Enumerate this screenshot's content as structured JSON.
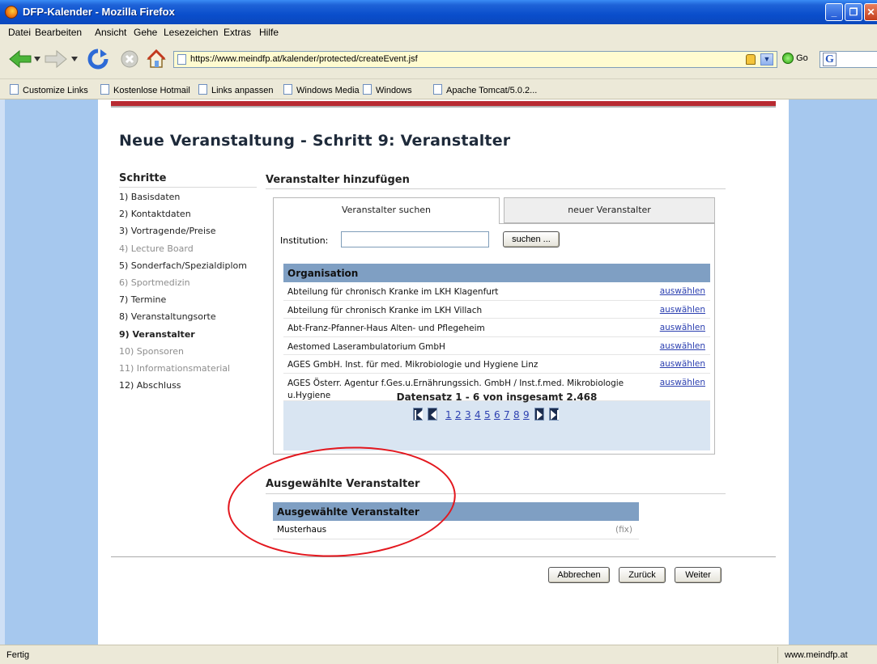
{
  "window": {
    "title": "DFP-Kalender - Mozilla Firefox"
  },
  "menu": [
    "Datei",
    "Bearbeiten",
    "Ansicht",
    "Gehe",
    "Lesezeichen",
    "Extras",
    "Hilfe"
  ],
  "nav": {
    "url": "https://www.meindfp.at/kalender/protected/createEvent.jsf",
    "go_label": "Go"
  },
  "bookmarks": [
    "Customize Links",
    "Kostenlose Hotmail",
    "Links anpassen",
    "Windows Media",
    "Windows",
    "Apache Tomcat/5.0.2..."
  ],
  "page": {
    "heading": "Neue Veranstaltung - Schritt 9: Veranstalter",
    "steps_title": "Schritte",
    "steps": [
      {
        "label": "1) Basisdaten",
        "state": "normal"
      },
      {
        "label": "2) Kontaktdaten",
        "state": "normal"
      },
      {
        "label": "3) Vortragende/Preise",
        "state": "normal"
      },
      {
        "label": "4) Lecture Board",
        "state": "dim"
      },
      {
        "label": "5) Sonderfach/Spezialdiplom",
        "state": "normal"
      },
      {
        "label": "6) Sportmedizin",
        "state": "dim"
      },
      {
        "label": "7) Termine",
        "state": "normal"
      },
      {
        "label": "8) Veranstaltungsorte",
        "state": "normal"
      },
      {
        "label": "9) Veranstalter",
        "state": "active"
      },
      {
        "label": "10) Sponsoren",
        "state": "dim"
      },
      {
        "label": "11) Informationsmaterial",
        "state": "dim"
      },
      {
        "label": "12) Abschluss",
        "state": "normal"
      }
    ],
    "add_section_title": "Veranstalter hinzufügen",
    "tabs": {
      "search": "Veranstalter suchen",
      "new": "neuer Veranstalter"
    },
    "institution_label": "Institution:",
    "institution_value": "",
    "search_button": "suchen ...",
    "table_header": "Organisation",
    "rows": [
      {
        "name": "Abteilung für chronisch Kranke im LKH Klagenfurt",
        "action": "auswählen"
      },
      {
        "name": "Abteilung für chronisch Kranke im LKH Villach",
        "action": "auswählen"
      },
      {
        "name": "Abt-Franz-Pfanner-Haus Alten- und Pflegeheim",
        "action": "auswählen"
      },
      {
        "name": "Aestomed Laserambulatorium GmbH",
        "action": "auswählen"
      },
      {
        "name": "AGES GmbH. Inst. für med. Mikrobiologie und Hygiene Linz",
        "action": "auswählen"
      },
      {
        "name": "AGES Österr. Agentur f.Ges.u.Ernährungssich. GmbH / Inst.f.med. Mikrobiologie u.Hygiene",
        "action": "auswählen"
      }
    ],
    "pager_text": "Datensatz 1 - 6 von insgesamt 2.468",
    "pages": [
      "1",
      "2",
      "3",
      "4",
      "5",
      "6",
      "7",
      "8",
      "9"
    ],
    "selected_section_title": "Ausgewählte Veranstalter",
    "selected_table_header": "Ausgewählte Veranstalter",
    "selected": [
      {
        "name": "Musterhaus",
        "tag": "(fix)"
      }
    ],
    "buttons": {
      "cancel": "Abbrechen",
      "back": "Zurück",
      "next": "Weiter"
    }
  },
  "status": {
    "text": "Fertig",
    "host": "www.meindfp.at"
  },
  "colors": {
    "header_blue": "#7f9fc3",
    "panel_blue": "#d9e5f2",
    "accent_red": "#b82a31",
    "annotation_red": "#e3171e"
  }
}
